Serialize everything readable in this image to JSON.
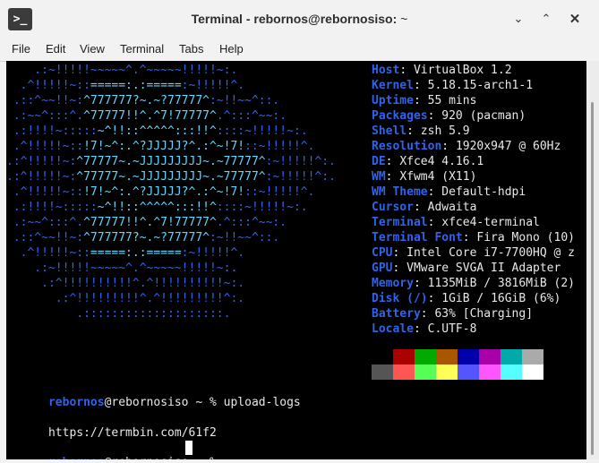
{
  "window": {
    "title_main": "Terminal - rebornos@rebornosiso:",
    "title_sub": "~",
    "app_icon_glyph": ">_",
    "minimize_glyph": "⌄",
    "maximize_glyph": "⌃",
    "close_glyph": "✕"
  },
  "menu": [
    "File",
    "Edit",
    "View",
    "Terminal",
    "Tabs",
    "Help"
  ],
  "logo_lines": [
    [
      [
        "a",
        "    .:~!!!!!~~~~~^.^~~~~~!!!!!~:."
      ]
    ],
    [
      [
        "a",
        "  .^!!!!!~::"
      ],
      [
        "b",
        "=====:.:====="
      ],
      [
        "a",
        ":~!!!!!^."
      ]
    ],
    [
      [
        "a",
        " .::^~~!!~:"
      ],
      [
        "b",
        "^777777?~.~?77777^"
      ],
      [
        "a",
        ":~!!~~^::."
      ]
    ],
    [
      [
        "a",
        " .:~~^:::^."
      ],
      [
        "b",
        "^77777!!^.^7!77777^"
      ],
      [
        "a",
        ".^:::^~~:."
      ]
    ],
    [
      [
        "a",
        " .:!!!!~:::::"
      ],
      [
        "b",
        "~^!!::^^^^^:::!!^"
      ],
      [
        "a",
        "::::~!!!!!~:."
      ]
    ],
    [
      [
        "a",
        " .^!!!!!~::"
      ],
      [
        "b",
        "!7!~^:.^?JJJJJ?^.:^~!7!"
      ],
      [
        "a",
        "::~!!!!!^."
      ]
    ],
    [
      [
        "a",
        ".:^!!!!!~:"
      ],
      [
        "b",
        "^77777~.~JJJJJJJJJ~.~77777^"
      ],
      [
        "a",
        ":~!!!!!^:."
      ]
    ],
    [
      [
        "a",
        ".:^!!!!!~:"
      ],
      [
        "b",
        "^77777~.~JJJJJJJJJ~.~77777^"
      ],
      [
        "a",
        ":~!!!!!^:."
      ]
    ],
    [
      [
        "a",
        " .^!!!!!~::"
      ],
      [
        "b",
        "!7!~^:.^?JJJJJ?^.:^~!7!"
      ],
      [
        "a",
        "::~!!!!!^."
      ]
    ],
    [
      [
        "a",
        " .:!!!!~:::::"
      ],
      [
        "b",
        "~^!!::^^^^^:::!!^"
      ],
      [
        "a",
        "::::~!!!!!~:."
      ]
    ],
    [
      [
        "a",
        " .:~~^:::^."
      ],
      [
        "b",
        "^77777!!^.^7!77777^"
      ],
      [
        "a",
        ".^:::^~~:."
      ]
    ],
    [
      [
        "a",
        " .::^~~!!~:"
      ],
      [
        "b",
        "^777777?~.~?77777^"
      ],
      [
        "a",
        ":~!!~~^::."
      ]
    ],
    [
      [
        "a",
        "  .^!!!!!~::"
      ],
      [
        "b",
        "=====:.:====="
      ],
      [
        "a",
        ":~!!!!!^."
      ]
    ],
    [
      [
        "a",
        "    .:~!!!!!~~~~~^.^~~~~~!!!!!~:."
      ]
    ],
    [
      [
        "a",
        "     .:^!!!!!!!!!!^.^!!!!!!!!!!~:."
      ]
    ],
    [
      [
        "a",
        "       .:^!!!!!!!!!^.^!!!!!!!!!^:."
      ]
    ],
    [
      [
        "a",
        "          .::::::::::::::::::::."
      ]
    ]
  ],
  "info": [
    {
      "key": "Host",
      "value": "VirtualBox 1.2"
    },
    {
      "key": "Kernel",
      "value": "5.18.15-arch1-1"
    },
    {
      "key": "Uptime",
      "value": "55 mins"
    },
    {
      "key": "Packages",
      "value": "920 (pacman)"
    },
    {
      "key": "Shell",
      "value": "zsh 5.9"
    },
    {
      "key": "Resolution",
      "value": "1920x947 @ 60Hz"
    },
    {
      "key": "DE",
      "value": "Xfce4 4.16.1"
    },
    {
      "key": "WM",
      "value": "Xfwm4 (X11)"
    },
    {
      "key": "WM Theme",
      "value": "Default-hdpi"
    },
    {
      "key": "Cursor",
      "value": "Adwaita"
    },
    {
      "key": "Terminal",
      "value": "xfce4-terminal"
    },
    {
      "key": "Terminal Font",
      "value": "Fira Mono (10)"
    },
    {
      "key": "CPU",
      "value": "Intel Core i7-7700HQ @ z"
    },
    {
      "key": "GPU",
      "value": "VMware SVGA II Adapter"
    },
    {
      "key": "Memory",
      "value": "1135MiB / 3816MiB (2)"
    },
    {
      "key": "Disk (/)",
      "value": "1GiB / 16GiB (6%)"
    },
    {
      "key": "Battery",
      "value": "63% [Charging]"
    },
    {
      "key": "Locale",
      "value": "C.UTF-8"
    }
  ],
  "palette_top": [
    "#000000",
    "#aa0000",
    "#00aa00",
    "#aa5500",
    "#0000aa",
    "#aa00aa",
    "#00aaaa",
    "#aaaaaa"
  ],
  "palette_bottom": [
    "#555555",
    "#ff5555",
    "#55ff55",
    "#ffff55",
    "#5555ff",
    "#ff55ff",
    "#55ffff",
    "#ffffff"
  ],
  "prompt": {
    "user": "rebornos",
    "rest": "@rebornosiso ~ % "
  },
  "command": "upload-logs",
  "output": "https://termbin.com/61f2"
}
